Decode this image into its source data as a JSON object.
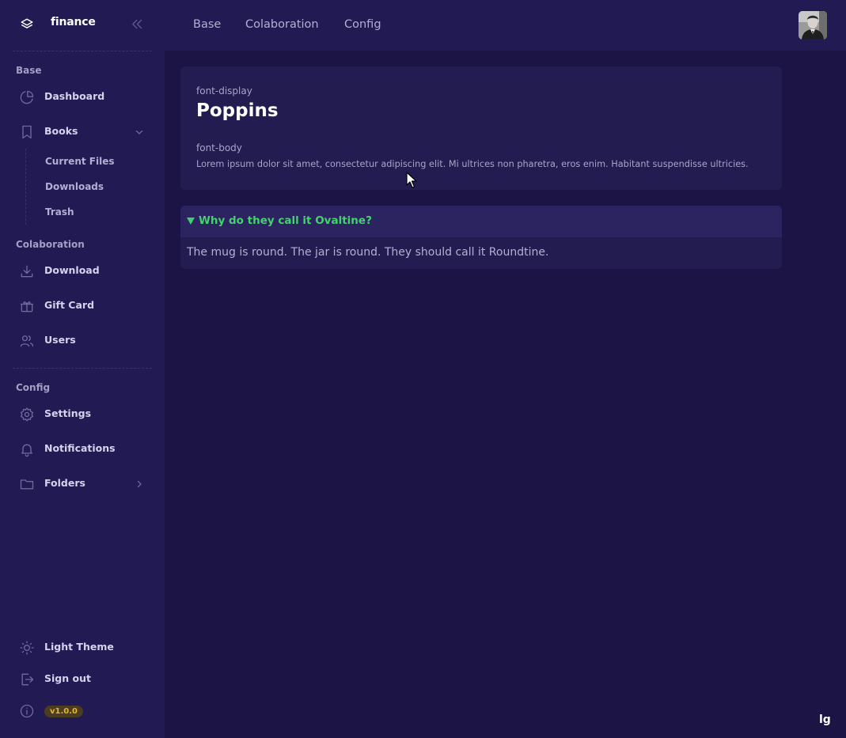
{
  "brand": {
    "name": "finance"
  },
  "topnav": {
    "tabs": [
      "Base",
      "Colaboration",
      "Config"
    ]
  },
  "sidebar": {
    "sections": {
      "base": "Base",
      "colaboration": "Colaboration",
      "config": "Config"
    },
    "items": {
      "dashboard": "Dashboard",
      "books": "Books",
      "download": "Download",
      "gift_card": "Gift Card",
      "users": "Users",
      "settings": "Settings",
      "notifications": "Notifications",
      "folders": "Folders",
      "light_theme": "Light Theme",
      "sign_out": "Sign out"
    },
    "books_children": [
      "Current Files",
      "Downloads",
      "Trash"
    ],
    "version": "v1.0.0"
  },
  "card": {
    "display_key": "font-display",
    "display_value": "Poppins",
    "body_key": "font-body",
    "body_text": "Lorem ipsum dolor sit amet, consectetur adipiscing elit. Mi ultrices non pharetra, eros enim. Habitant suspendisse ultricies."
  },
  "details": {
    "question": "Why do they call it Ovaltine?",
    "answer": "The mug is round. The jar is round. They should call it Roundtine."
  },
  "breakpoint": "lg",
  "colors": {
    "sidebar_bg": "#221a52",
    "page_bg": "#1b1444",
    "accent_green": "#44d26e",
    "badge_amber": "#e8b130"
  },
  "icons": {
    "logo": "layers-icon",
    "collapse": "chevrons-left-icon",
    "dashboard": "pie-chart-icon",
    "books": "bookmark-icon",
    "download": "download-icon",
    "gift_card": "gift-icon",
    "users": "users-icon",
    "settings": "gear-icon",
    "notifications": "bell-icon",
    "folders": "folder-icon",
    "light_theme": "sun-icon",
    "sign_out": "logout-icon",
    "version_info": "info-icon"
  }
}
